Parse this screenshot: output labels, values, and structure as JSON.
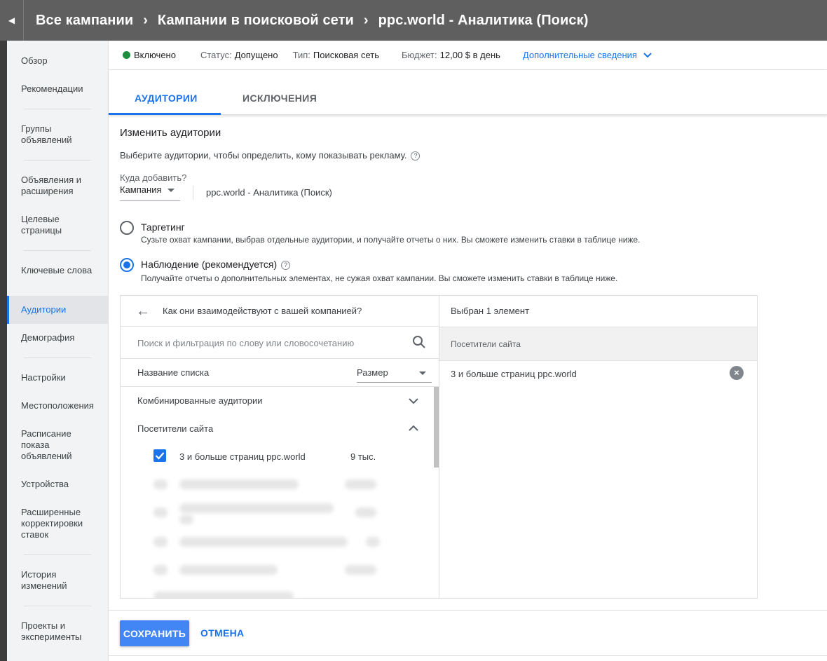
{
  "header": {
    "collapse_icon": "triangle-left",
    "breadcrumbs": [
      "Все кампании",
      "Кампании в поисковой сети",
      "ppc.world - Аналитика (Поиск)"
    ],
    "separator": "›"
  },
  "sidebar": {
    "items": [
      {
        "label": "Обзор"
      },
      {
        "label": "Рекомендации"
      },
      {
        "label": "Группы объявлений"
      },
      {
        "label": "Объявления и расширения"
      },
      {
        "label": "Целевые страницы"
      },
      {
        "label": "Ключевые слова"
      },
      {
        "label": "Аудитории",
        "active": true
      },
      {
        "label": "Демография"
      },
      {
        "label": "Настройки"
      },
      {
        "label": "Местоположения"
      },
      {
        "label": "Расписание показа объявлений"
      },
      {
        "label": "Устройства"
      },
      {
        "label": "Расширенные корректировки ставок"
      },
      {
        "label": "История изменений"
      },
      {
        "label": "Проекты и эксперименты"
      }
    ]
  },
  "status": {
    "enabled": "Включено",
    "status_label": "Статус:",
    "status_value": "Допущено",
    "type_label": "Тип:",
    "type_value": "Поисковая сеть",
    "budget_label": "Бюджет:",
    "budget_value": "12,00 $ в день",
    "more_link": "Дополнительные сведения",
    "enabled_color": "#1e8e3e"
  },
  "tabs": [
    {
      "label": "АУДИТОРИИ",
      "active": true
    },
    {
      "label": "ИСКЛЮЧЕНИЯ",
      "active": false
    }
  ],
  "edit": {
    "title": "Изменить аудитории",
    "description": "Выберите аудитории, чтобы определить, кому показывать рекламу.",
    "where_label": "Куда добавить?",
    "where_select": "Кампания",
    "where_value": "ppc.world - Аналитика (Поиск)"
  },
  "options": {
    "targeting_title": "Таргетинг",
    "targeting_desc": "Сузьте охват кампании, выбрав отдельные аудитории, и получайте отчеты о них. Вы сможете изменить ставки в таблице ниже.",
    "observation_title": "Наблюдение (рекомендуется)",
    "observation_desc": "Получайте отчеты о дополнительных элементах, не сужая охват кампании. Вы сможете изменить ставки в таблице ниже.",
    "selected": "observation"
  },
  "browser": {
    "heading": "Как они взаимодействуют с вашей компанией?",
    "search_placeholder": "Поиск и фильтрация по слову или словосочетанию",
    "col_name": "Название списка",
    "col_size": "Размер",
    "groups": [
      {
        "label": "Комбинированные аудитории",
        "expanded": false
      },
      {
        "label": "Посетители сайта",
        "expanded": true
      }
    ],
    "checked_item": {
      "label": "3 и больше страниц ppc.world",
      "size": "9 тыс.",
      "checked": true
    }
  },
  "selected_panel": {
    "heading": "Выбран 1 элемент",
    "section": "Посетители сайта",
    "item": "3 и больше страниц ppc.world"
  },
  "footer": {
    "save": "СОХРАНИТЬ",
    "cancel": "ОТМЕНА"
  },
  "colors": {
    "accent": "#1a73e8",
    "header_bg": "#5f5f5f",
    "save_button": "#4285f4"
  }
}
